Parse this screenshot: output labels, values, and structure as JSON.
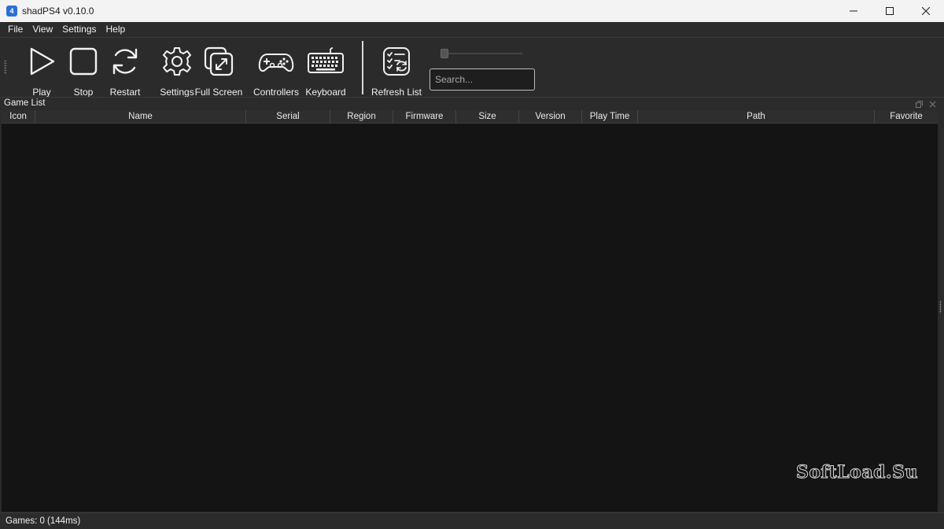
{
  "window": {
    "title": "shadPS4 v0.10.0",
    "app_icon_glyph": "4"
  },
  "menu": [
    "File",
    "View",
    "Settings",
    "Help"
  ],
  "toolbar": {
    "play_label": "Play",
    "stop_label": "Stop",
    "restart_label": "Restart",
    "settings_label": "Settings",
    "fullscreen_label": "Full Screen",
    "controllers_label": "Controllers",
    "keyboard_label": "Keyboard",
    "refresh_label": "Refresh List",
    "search_placeholder": "Search...",
    "icon_size_slider_value": 0
  },
  "dock": {
    "title": "Game List"
  },
  "table": {
    "columns": [
      "Icon",
      "Name",
      "Serial",
      "Region",
      "Firmware",
      "Size",
      "Version",
      "Play Time",
      "Path",
      "Favorite"
    ],
    "rows": []
  },
  "status": {
    "text": "Games: 0 (144ms)"
  },
  "watermark": "SoftLoad.Su",
  "colors": {
    "background": "#2b2b2b",
    "table_background": "#141414",
    "titlebar": "#f3f3f3",
    "app_icon": "#2a6fd6"
  }
}
